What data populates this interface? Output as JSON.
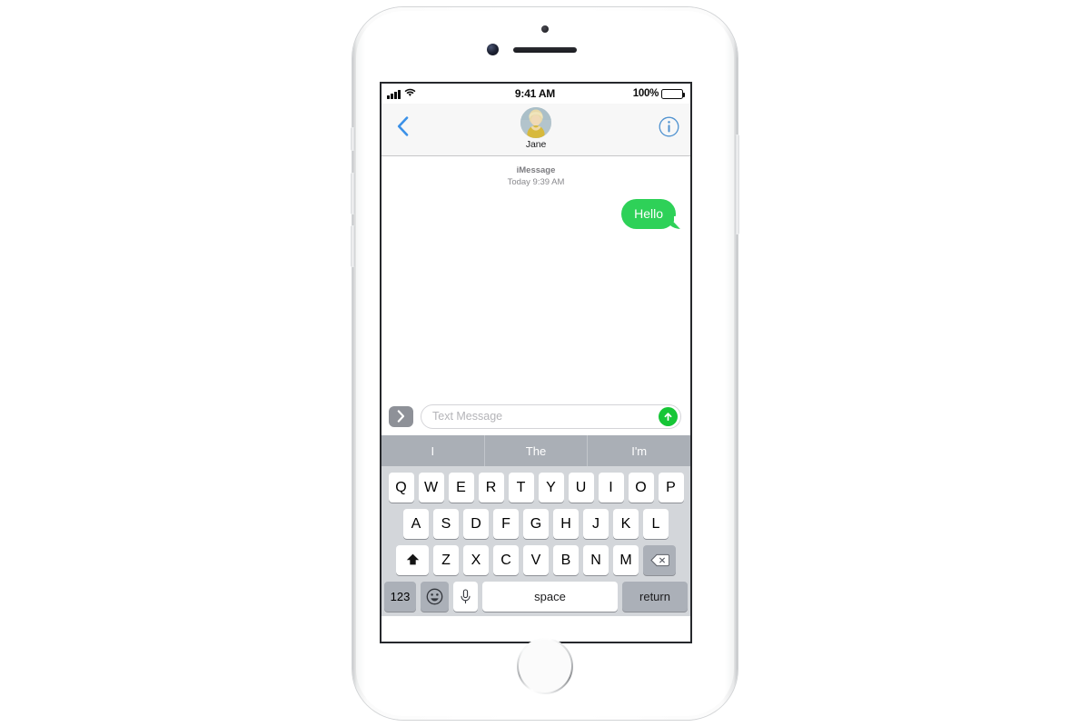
{
  "device": {
    "name": "iPhone",
    "hardware": {
      "earpiece": "earpiece-speaker",
      "front_camera": "front-camera",
      "sensor": "proximity-sensor",
      "home_button": "home-button",
      "mute_switch": "mute-switch",
      "volume_up": "volume-up-button",
      "volume_down": "volume-down-button",
      "power": "power-button"
    }
  },
  "status_bar": {
    "signal_icon": "cellular-signal-icon",
    "signal_bars": 4,
    "wifi_icon": "wifi-icon",
    "time": "9:41 AM",
    "battery_percent": "100%",
    "battery_icon": "battery-full-icon"
  },
  "nav_bar": {
    "back_icon": "chevron-left-icon",
    "contact_name": "Jane",
    "avatar_icon": "contact-avatar",
    "info_icon": "info-circle-icon"
  },
  "conversation": {
    "service_label": "iMessage",
    "timestamp": "Today 9:39 AM",
    "messages": [
      {
        "text": "Hello",
        "direction": "sent",
        "bubble_color": "#2ED158",
        "text_color": "#FFFFFF"
      }
    ]
  },
  "input_bar": {
    "apps_icon": "chevron-right-icon",
    "placeholder": "Text Message",
    "value": "",
    "send_icon": "arrow-up-icon",
    "send_color": "#16C636"
  },
  "keyboard": {
    "predictive": [
      "I",
      "The",
      "I'm"
    ],
    "row1": [
      "Q",
      "W",
      "E",
      "R",
      "T",
      "Y",
      "U",
      "I",
      "O",
      "P"
    ],
    "row2": [
      "A",
      "S",
      "D",
      "F",
      "G",
      "H",
      "J",
      "K",
      "L"
    ],
    "row3": [
      "Z",
      "X",
      "C",
      "V",
      "B",
      "N",
      "M"
    ],
    "shift_icon": "shift-arrow-icon",
    "delete_icon": "backspace-icon",
    "numeric_label": "123",
    "emoji_icon": "emoji-smiley-icon",
    "mic_icon": "microphone-icon",
    "space_label": "space",
    "return_label": "return"
  },
  "colors": {
    "keyboard_bg": "#D3D6DA",
    "predictive_bg": "#AAAFB6",
    "key_bg": "#FFFFFF",
    "key_dark_bg": "#ABB0B8",
    "nav_bg": "#F7F7F7",
    "accent_blue": "#3B91E8"
  }
}
